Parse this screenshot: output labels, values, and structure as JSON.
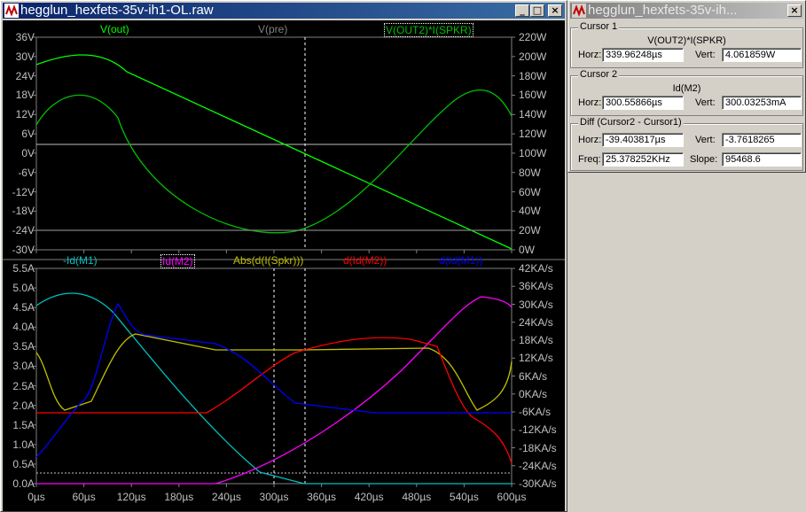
{
  "main_window": {
    "title": "hegglun_hexfets-35v-ih1-OL.raw",
    "buttons": {
      "minimize": "_",
      "maximize": "□",
      "close": "×"
    }
  },
  "top_plot": {
    "traces": [
      {
        "label": "V(out)",
        "color": "#00ff00"
      },
      {
        "label": "V(pre)",
        "color": "#808080"
      },
      {
        "label": "V(OUT2)*I(SPKR)",
        "color": "#00c000",
        "boxed": true
      }
    ],
    "left_ticks": [
      "36V",
      "30V",
      "24V",
      "18V",
      "12V",
      "6V",
      "0V",
      "-6V",
      "-12V",
      "-18V",
      "-24V",
      "-30V"
    ],
    "right_ticks": [
      "220W",
      "200W",
      "180W",
      "160W",
      "140W",
      "120W",
      "100W",
      "80W",
      "60W",
      "40W",
      "20W",
      "0W"
    ]
  },
  "bottom_plot": {
    "traces": [
      {
        "label": "-Id(M1)",
        "color": "#00c0c0"
      },
      {
        "label": "Id(M2)",
        "color": "#ff00ff",
        "boxed": true
      },
      {
        "label": "Abs(d(I(Spkr)))",
        "color": "#c0c000"
      },
      {
        "label": "d(Id(M2))",
        "color": "#ff0000"
      },
      {
        "label": "d(Id(M1))",
        "color": "#0000ff"
      }
    ],
    "left_ticks": [
      "5.5A",
      "5.0A",
      "4.5A",
      "4.0A",
      "3.5A",
      "3.0A",
      "2.5A",
      "2.0A",
      "1.5A",
      "1.0A",
      "0.5A",
      "0.0A"
    ],
    "right_ticks": [
      "42KA/s",
      "36KA/s",
      "30KA/s",
      "24KA/s",
      "18KA/s",
      "12KA/s",
      "6KA/s",
      "0KA/s",
      "-6KA/s",
      "-12KA/s",
      "-18KA/s",
      "-24KA/s",
      "-30KA/s"
    ]
  },
  "x_ticks": [
    "0µs",
    "60µs",
    "120µs",
    "180µs",
    "240µs",
    "300µs",
    "360µs",
    "420µs",
    "480µs",
    "540µs",
    "600µs"
  ],
  "cursor_window": {
    "title": "hegglun_hexfets-35v-ih...",
    "close": "×",
    "cursor1": {
      "group": "Cursor 1",
      "trace": "V(OUT2)*I(SPKR)",
      "horz_label": "Horz:",
      "horz": "339.96248µs",
      "vert_label": "Vert:",
      "vert": "4.061859W"
    },
    "cursor2": {
      "group": "Cursor 2",
      "trace": "Id(M2)",
      "horz_label": "Horz:",
      "horz": "300.55866µs",
      "vert_label": "Vert:",
      "vert": "300.03253mA"
    },
    "diff": {
      "group": "Diff (Cursor2 - Cursor1)",
      "horz_label": "Horz:",
      "horz": "-39.403817µs",
      "vert_label": "Vert:",
      "vert": "-3.7618265",
      "freq_label": "Freq:",
      "freq": "25.378252KHz",
      "slope_label": "Slope:",
      "slope": "95468.6"
    }
  }
}
